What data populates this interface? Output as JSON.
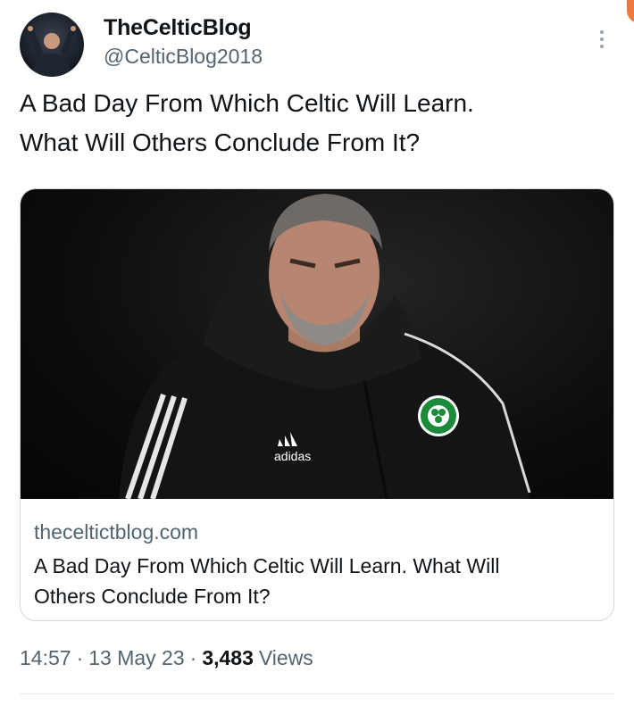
{
  "tweet": {
    "author": {
      "display_name": "TheCelticBlog",
      "handle": "@CelticBlog2018"
    },
    "text_lines": [
      "A Bad Day From Which Celtic Will Learn.",
      "What Will Others Conclude From It?"
    ],
    "more_icon": "more-vertical-icon",
    "card": {
      "domain": "theceltictblog.com",
      "title_lines": [
        "A Bad Day From Which Celtic Will Learn. What Will",
        "Others Conclude From It?"
      ],
      "image_text": {
        "brand": "adidas",
        "crest": "CELTIC FOOTBALL CLUB"
      }
    },
    "meta": {
      "time": "14:57",
      "separator": "·",
      "date": "13 May 23",
      "views_count": "3,483",
      "views_label": "Views"
    }
  },
  "colors": {
    "text": "#0f1419",
    "secondary": "#536471",
    "border": "#cfd9de",
    "accent": "#f0783c"
  }
}
